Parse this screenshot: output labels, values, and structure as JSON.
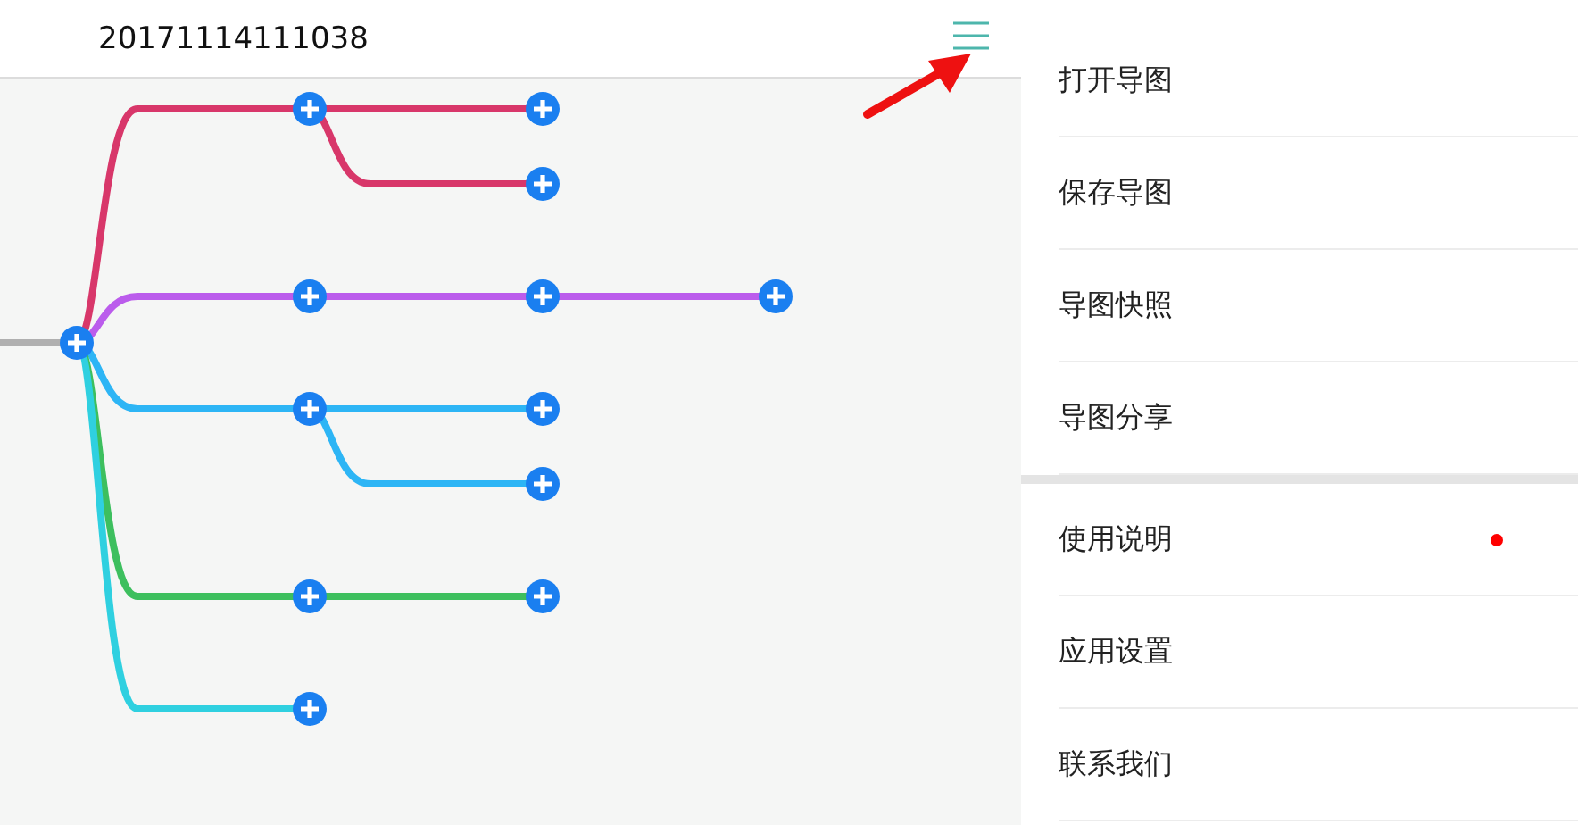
{
  "header": {
    "title": "20171114111038"
  },
  "mind_map": {
    "root": {
      "kind": "node",
      "children": [
        {
          "kind": "node",
          "color": "#d8376a",
          "children": [
            {
              "kind": "node"
            },
            {
              "kind": "node"
            }
          ]
        },
        {
          "kind": "node",
          "color": "#bb5cec",
          "children": [
            {
              "kind": "node",
              "children": [
                {
                  "kind": "node"
                }
              ]
            }
          ]
        },
        {
          "kind": "node",
          "color": "#2db5f5",
          "children": [
            {
              "kind": "node"
            },
            {
              "kind": "node"
            }
          ]
        },
        {
          "kind": "node",
          "color": "#3dbf5e",
          "children": [
            {
              "kind": "node"
            }
          ]
        },
        {
          "kind": "node",
          "color": "#2fd0e0"
        }
      ]
    }
  },
  "menu": {
    "groups": [
      [
        {
          "label": "打开导图",
          "badge": false
        },
        {
          "label": "保存导图",
          "badge": false
        },
        {
          "label": "导图快照",
          "badge": false
        },
        {
          "label": "导图分享",
          "badge": false
        }
      ],
      [
        {
          "label": "使用说明",
          "badge": true
        },
        {
          "label": "应用设置",
          "badge": false
        },
        {
          "label": "联系我们",
          "badge": false
        }
      ]
    ]
  }
}
